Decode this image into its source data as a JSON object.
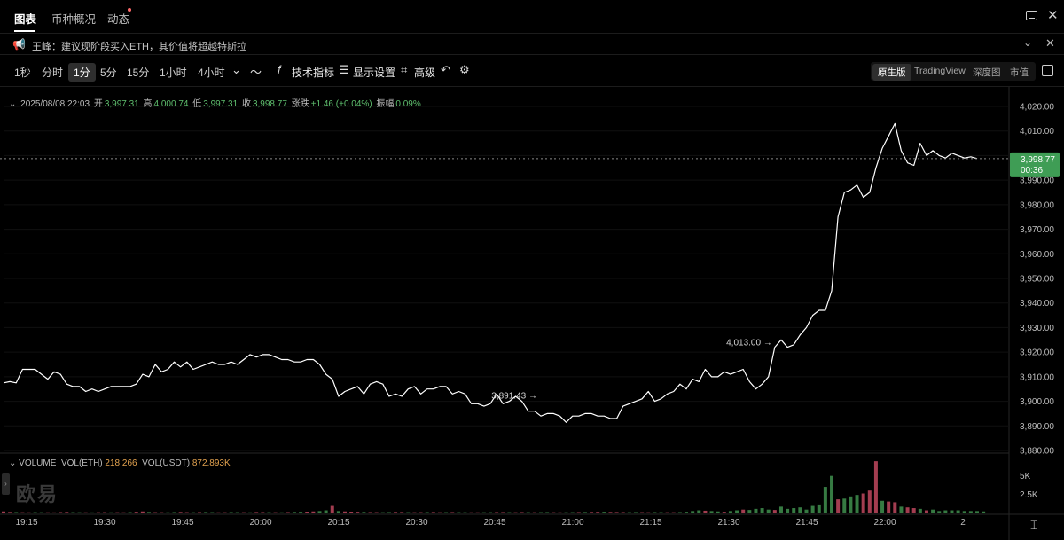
{
  "nav": {
    "tabs": [
      "图表",
      "币种概况",
      "动态"
    ],
    "active_tab": "图表"
  },
  "ticker": {
    "speaker_icon": "speaker-icon",
    "text": "王峰：建议现阶段买入ETH，其价值将超越特斯拉"
  },
  "toolbar": {
    "timeframes": [
      "1秒",
      "分时",
      "1分",
      "5分",
      "15分",
      "1小时",
      "4小时"
    ],
    "active_timeframe": "1分",
    "tools": {
      "indicators": "技术指标",
      "display": "显示设置",
      "advanced": "高级"
    },
    "views": [
      "原生版",
      "TradingView",
      "深度图",
      "市值"
    ],
    "active_view": "原生版"
  },
  "ohlc": {
    "datetime": "2025/08/08 22:03",
    "open_label": "开",
    "open": "3,997.31",
    "high_label": "高",
    "high": "4,000.74",
    "low_label": "低",
    "low": "3,997.31",
    "close_label": "收",
    "close": "3,998.77",
    "change_label": "涨跌",
    "change": "+1.46 (+0.04%)",
    "amp_label": "振幅",
    "amp": "0.09%"
  },
  "volume_legend": {
    "name": "VOLUME",
    "eth_label": "VOL(ETH)",
    "eth": "218.266",
    "usdt_label": "VOL(USDT)",
    "usdt": "872.893K"
  },
  "watermark": "欧易",
  "colors": {
    "up": "#3f8f4e",
    "down": "#c0485e",
    "price_tag": "#3f9d55",
    "line": "#ffffff"
  },
  "chart_data": {
    "type": "line",
    "x_ticks": [
      "19:15",
      "19:30",
      "19:45",
      "20:00",
      "20:15",
      "20:30",
      "20:45",
      "21:00",
      "21:15",
      "21:30",
      "21:45",
      "22:00",
      "2"
    ],
    "y_ticks": [
      "4,020.00",
      "4,010.00",
      "4,000.00",
      "3,990.00",
      "3,980.00",
      "3,970.00",
      "3,960.00",
      "3,950.00",
      "3,940.00",
      "3,930.00",
      "3,920.00",
      "3,910.00",
      "3,900.00",
      "3,890.00",
      "3,880.00"
    ],
    "ylim": [
      3880,
      4020
    ],
    "vol_ticks": [
      "5K",
      "2.5K"
    ],
    "vol_max": 7500,
    "current_price": "3,998.77",
    "countdown": "00:36",
    "high_annotation": "4,013.00",
    "low_annotation": "3,891.43",
    "high_index": 122,
    "low_index": 78,
    "prices": [
      3907.5,
      3908,
      3907.5,
      3913,
      3913,
      3913,
      3911,
      3909,
      3912,
      3911,
      3907,
      3906,
      3906,
      3904,
      3905,
      3904,
      3905,
      3906,
      3906,
      3906,
      3906,
      3907,
      3911,
      3910,
      3915,
      3912,
      3913,
      3916,
      3914,
      3916,
      3913,
      3914,
      3915,
      3916,
      3915,
      3915,
      3916,
      3915,
      3917,
      3919,
      3918,
      3919,
      3919,
      3918,
      3917,
      3917,
      3916,
      3916,
      3917,
      3917,
      3915,
      3911,
      3909,
      3902,
      3904,
      3905,
      3906,
      3903,
      3907,
      3908,
      3907,
      3902,
      3903,
      3902,
      3905,
      3906,
      3903,
      3905,
      3905,
      3906,
      3906,
      3903,
      3904,
      3903,
      3899,
      3899,
      3898,
      3899,
      3903,
      3899,
      3900,
      3902,
      3900,
      3896,
      3896,
      3894,
      3895,
      3895,
      3894,
      3891.43,
      3894,
      3894,
      3895,
      3895,
      3894,
      3894,
      3893,
      3893,
      3898,
      3899,
      3900,
      3901,
      3904,
      3900,
      3901,
      3903,
      3904,
      3907,
      3905,
      3909,
      3908,
      3913,
      3910,
      3910,
      3912,
      3911,
      3912,
      3913,
      3908,
      3905,
      3907,
      3910,
      3922,
      3925,
      3922,
      3923,
      3927,
      3930,
      3935,
      3937,
      3937,
      3945,
      3975,
      3985,
      3986,
      3988,
      3983,
      3985,
      3995,
      4003,
      4008,
      4013,
      4002,
      3997,
      3996,
      4005,
      4000,
      4002,
      4000,
      3999,
      4001,
      4000,
      3999,
      3999.5,
      3998.77
    ],
    "volumes": [
      150,
      80,
      60,
      40,
      30,
      50,
      40,
      30,
      20,
      60,
      80,
      50,
      40,
      30,
      20,
      40,
      50,
      30,
      40,
      30,
      60,
      100,
      150,
      80,
      50,
      40,
      30,
      60,
      80,
      50,
      40,
      60,
      70,
      50,
      30,
      40,
      60,
      50,
      40,
      30,
      70,
      60,
      50,
      40,
      30,
      60,
      80,
      100,
      120,
      150,
      200,
      300,
      900,
      200,
      150,
      120,
      100,
      80,
      60,
      50,
      40,
      60,
      80,
      70,
      50,
      40,
      50,
      60,
      70,
      40,
      50,
      60,
      50,
      40,
      30,
      30,
      40,
      50,
      60,
      60,
      50,
      40,
      60,
      50,
      40,
      50,
      60,
      40,
      30,
      40,
      50,
      60,
      70,
      80,
      90,
      100,
      80,
      70,
      60,
      50,
      60,
      50,
      40,
      60,
      50,
      40,
      40,
      60,
      100,
      200,
      300,
      250,
      200,
      150,
      100,
      200,
      300,
      400,
      350,
      500,
      600,
      400,
      350,
      800,
      500,
      600,
      700,
      400,
      900,
      1100,
      3500,
      5000,
      1800,
      1900,
      2200,
      2400,
      2600,
      3000,
      7000,
      1600,
      1500,
      1400,
      800,
      700,
      600,
      500,
      300,
      400,
      200,
      300,
      300,
      300,
      200,
      200,
      200,
      150
    ],
    "vol_dirs": "ddudduudddduududdudduddudduudduduudduududdududuudduududddudduudduddudduduudduuddudduduudduududduddduudduudduuuuduuduuduuuuduuuuuuuuuduuudddudduddudu"
  }
}
